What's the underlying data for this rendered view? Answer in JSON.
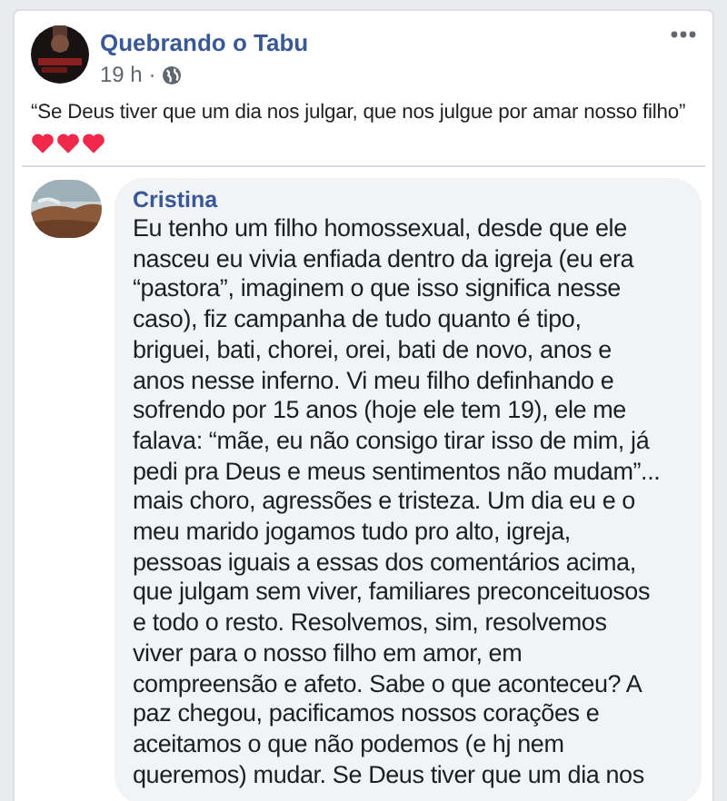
{
  "post": {
    "author": "Quebrando o Tabu",
    "time": "19 h ·",
    "text": "“Se Deus tiver que um dia nos julgar, que nos julgue por amar nosso filho”"
  },
  "comment": {
    "author": "Cristina",
    "text": "Eu tenho um filho homossexual, desde que ele\nnasceu eu vivia enfiada dentro da igreja (eu era\n“pastora”, imaginem o que isso significa nesse\ncaso), fiz campanha de tudo quanto é tipo,\nbriguei, bati, chorei, orei, bati de novo, anos e\nanos nesse inferno. Vi meu filho definhando e\nsofrendo por 15 anos (hoje ele tem 19), ele me\nfalava: “mãe, eu não consigo tirar isso de mim, já\npedi pra Deus e meus sentimentos não mudam”...\nmais choro, agressões e tristeza. Um dia eu e o\nmeu marido jogamos tudo pro alto, igreja,\npessoas iguais a essas dos comentários acima,\nque julgam sem viver, familiares preconceituosos\ne todo o resto. Resolvemos, sim, resolvemos\nviver para o nosso filho em amor, em\ncompreensão e afeto. Sabe o que aconteceu? A\npaz chegou, pacificamos nossos corações e\naceitamos o que não podemos (e hj nem\nqueremos) mudar. Se Deus tiver que um dia nos"
  }
}
